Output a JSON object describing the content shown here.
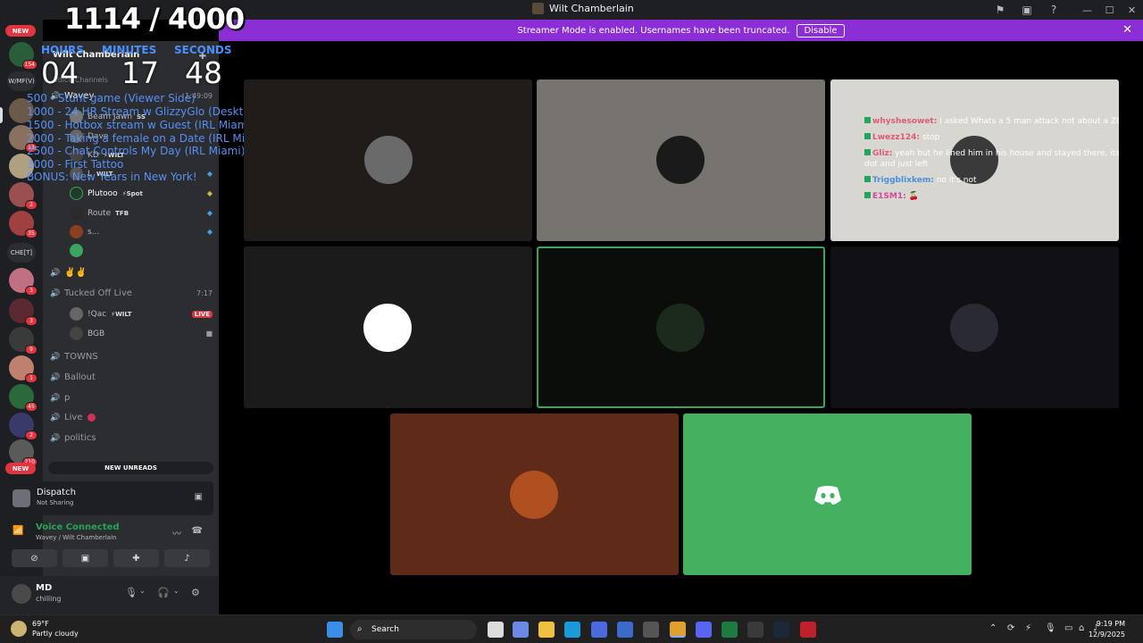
{
  "window": {
    "title": "Wilt Chamberlain"
  },
  "banner": {
    "text": "Streamer Mode is enabled. Usernames have been truncated.",
    "disable_label": "Disable"
  },
  "rail": {
    "new_top": "NEW",
    "new_bottom": "NEW",
    "badges": [
      "154",
      "3",
      "13",
      "2",
      "35",
      "3",
      "3",
      "9",
      "1",
      "45",
      "2",
      "210"
    ],
    "folders": [
      "W/MF(V)",
      "CHE[T]"
    ]
  },
  "overlay": {
    "count": "1114 / 4000",
    "labels": {
      "hours": "HOURS",
      "minutes": "MINUTES",
      "seconds": "SECONDS"
    },
    "time": {
      "hours": "04",
      "minutes": "17",
      "seconds": "48"
    },
    "items": [
      "500 - Stunt game (Viewer Side)",
      "1000 - 24 HR Stream w GlizzyGlo (Desktop)",
      "1500 - Hotbox stream w Guest (IRL Miami)",
      "2000 - Taking a female on a Date (IRL Miami)",
      "2500 - Chat Controls My Day (IRL Miami)",
      "3000 - First Tattoo",
      "BONUS: New Years in New York!"
    ]
  },
  "sidebar": {
    "server_name": "Wilt Chamberlain",
    "category": "Voice Channels",
    "channels": [
      {
        "name": "Wavey",
        "time": "1:49:09"
      },
      {
        "name": "✌️✌️",
        "time": ""
      },
      {
        "name": "Tucked Off Live",
        "time": "7:17"
      },
      {
        "name": "TOWNS",
        "time": ""
      },
      {
        "name": "Ballout",
        "time": ""
      },
      {
        "name": "p",
        "time": ""
      },
      {
        "name": "Live",
        "time": ""
      },
      {
        "name": "politics",
        "time": ""
      }
    ],
    "wavey_members": [
      {
        "name": "Beam Jawn",
        "tag": "SS"
      },
      {
        "name": "Dave",
        "tag": ""
      },
      {
        "name": "KD",
        "tag": "⚡WILT"
      },
      {
        "name": "L",
        "tag": "WILT"
      },
      {
        "name": "Plutooo",
        "tag": "⚡Spot"
      },
      {
        "name": "Route",
        "tag": "TFB"
      },
      {
        "name": "s...",
        "tag": ""
      }
    ],
    "tucked_members": [
      {
        "name": "!Qac",
        "tag": "⚡WILT",
        "live": "LIVE"
      },
      {
        "name": "BGB",
        "tag": "",
        "live": ""
      }
    ],
    "new_unreads": "NEW UNREADS"
  },
  "dispatch": {
    "title": "Dispatch",
    "subtitle": "Not Sharing"
  },
  "voice": {
    "status": "Voice Connected",
    "channel": "Wavey / Wilt Chamberlain"
  },
  "user": {
    "name": "MD",
    "status": "chilling"
  },
  "chat": [
    {
      "user": "whyshesowet:",
      "color": "#e05b77",
      "msg": "I asked Whats a 5 man attack not about a ZG report y"
    },
    {
      "user": "Lwezz124:",
      "color": "#e05b77",
      "msg": "stop"
    },
    {
      "user": "Gliz:",
      "color": "#e05b77",
      "msg": "yeah but he lined him in his house and stayed there, its n"
    },
    {
      "user": "",
      "color": "#ffffff",
      "msg": "dot and just left"
    },
    {
      "user": "Triggblixkem:",
      "color": "#4a8fe0",
      "msg": "no it's not"
    },
    {
      "user": "E1SM1:",
      "color": "#d04a9b",
      "msg": "🍒"
    }
  ],
  "taskbar": {
    "weather_temp": "69°F",
    "weather_desc": "Partly cloudy",
    "search_label": "Search",
    "time": "9:19 PM",
    "date": "12/9/2025"
  },
  "colors": {
    "accent": "#8c2ed6",
    "discord_green": "#3ba55d",
    "live_red": "#da373c"
  }
}
